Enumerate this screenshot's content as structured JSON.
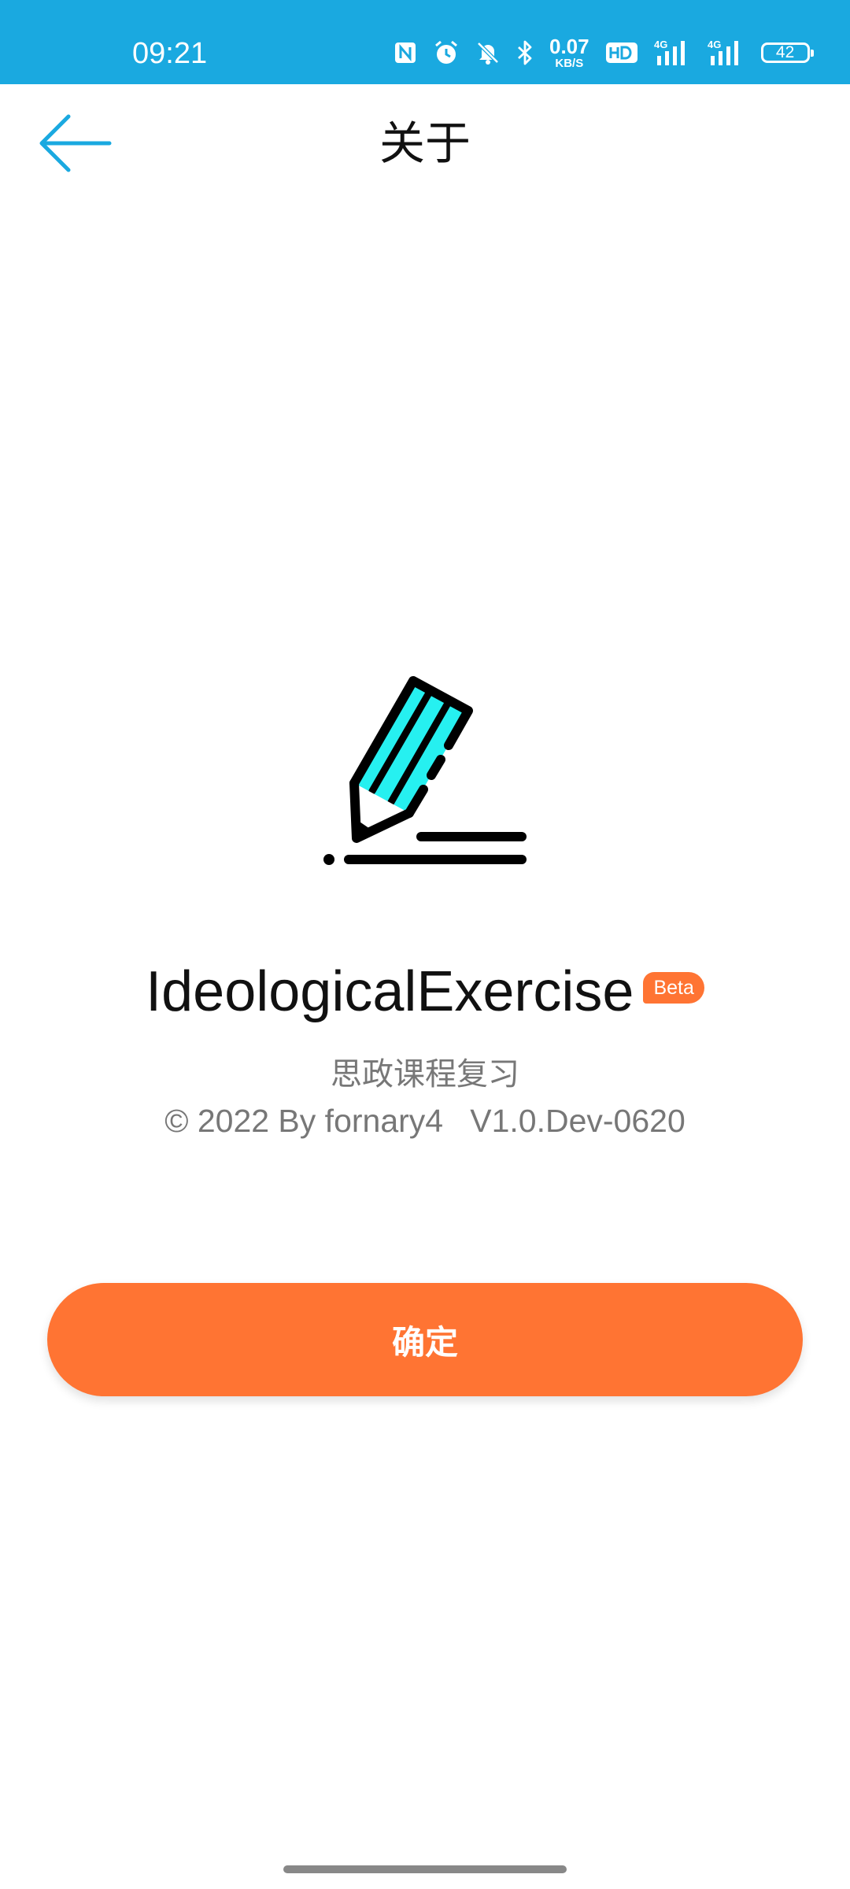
{
  "status_bar": {
    "time": "09:21",
    "network_speed_value": "0.07",
    "network_speed_unit": "KB/S",
    "battery_level": "42",
    "icons": [
      "nfc-icon",
      "alarm-icon",
      "mute-icon",
      "bluetooth-icon",
      "hd-icon",
      "signal-4g-icon",
      "signal-4g-icon",
      "battery-icon"
    ],
    "background_color": "#1aa9e0"
  },
  "header": {
    "title": "关于",
    "back_icon": "arrow-left-icon",
    "accent_color": "#1aa9e0"
  },
  "app": {
    "logo_icon": "pencil-icon",
    "name": "IdeologicalExercise",
    "badge": "Beta",
    "subtitle": "思政课程复习",
    "copyright": "© 2022 By fornary4   V1.0.Dev-0620"
  },
  "confirm_button": {
    "label": "确定",
    "color": "#ff7433"
  }
}
